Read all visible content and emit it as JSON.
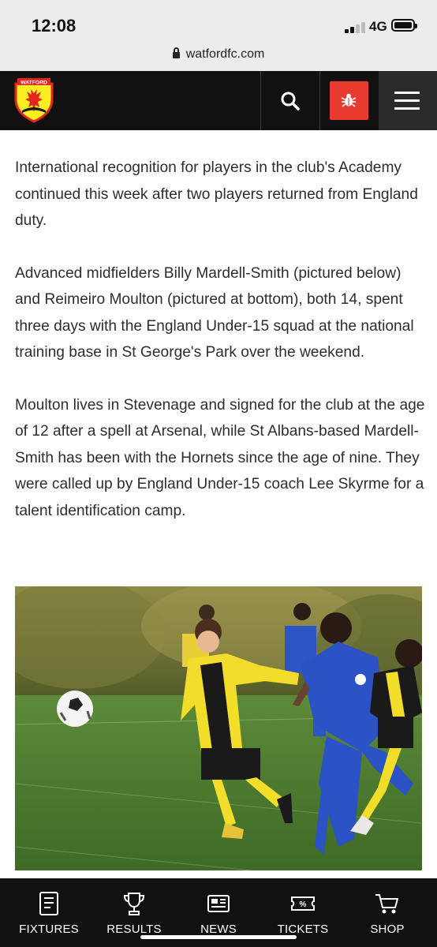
{
  "status_bar": {
    "time": "12:08",
    "network": "4G"
  },
  "browser": {
    "url": "watfordfc.com"
  },
  "header": {
    "logo_text": "WATFORD",
    "icons": [
      "search-icon",
      "bug-icon",
      "hamburger-menu-icon"
    ]
  },
  "article": {
    "paragraphs": [
      "International recognition for players in the club's Academy continued this week after two players returned from England duty.",
      "Advanced midfielders Billy Mardell-Smith (pictured below) and Reimeiro Moulton (pictured at bottom), both 14, spent three days with the England Under-15 squad at the national training base in St George's Park over the weekend.",
      "Moulton lives in Stevenage and signed for the club at the age of 12 after a spell at Arsenal, while St Albans-based Mardell-Smith has been with the Hornets since the age of nine. They were called up by England Under-15 coach Lee Skyrme for a talent identification camp."
    ]
  },
  "bottom_nav": {
    "items": [
      {
        "label": "FIXTURES",
        "icon": "fixtures-icon"
      },
      {
        "label": "RESULTS",
        "icon": "trophy-icon"
      },
      {
        "label": "NEWS",
        "icon": "newspaper-icon"
      },
      {
        "label": "TICKETS",
        "icon": "ticket-icon"
      },
      {
        "label": "SHOP",
        "icon": "cart-icon"
      }
    ]
  },
  "colors": {
    "header_bg": "#111111",
    "accent_red": "#e63b2e",
    "club_yellow": "#fbee23"
  }
}
